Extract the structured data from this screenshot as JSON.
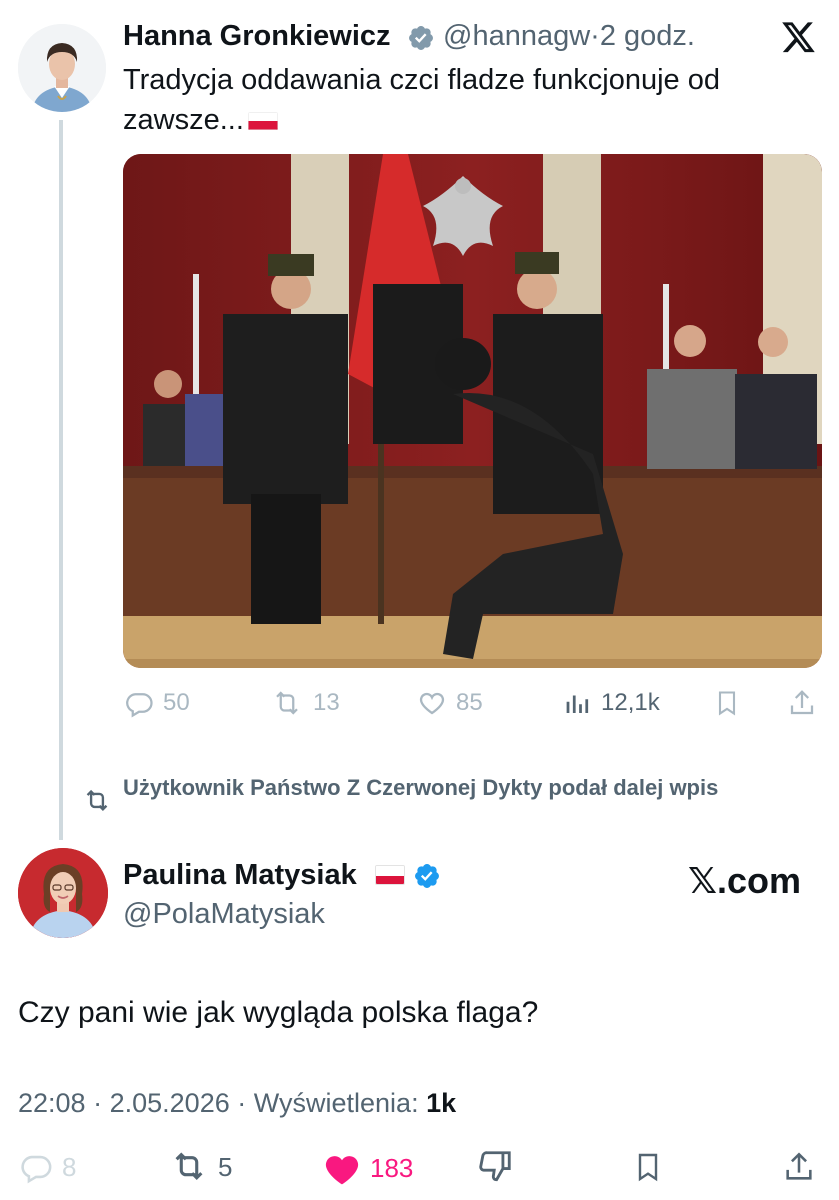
{
  "quoted_tweet": {
    "author_name": "Hanna Gronkiewicz",
    "handle": "@hannagw",
    "separator": "·",
    "time": "2 godz.",
    "text": "Tradycja oddawania czci fladze funkcjonuje od zawsze...",
    "actions": {
      "replies": "50",
      "reposts": "13",
      "likes": "85",
      "views": "12,1k"
    }
  },
  "repost_notice": "Użytkownik Państwo Z Czerwonej Dykty podał dalej wpis",
  "main_tweet": {
    "author_name": "Paulina Matysiak",
    "handle": "@PolaMatysiak",
    "text": "Czy pani wie jak wygląda polska flaga?",
    "time": "22:08",
    "date": "2.05.2026",
    "separator": "·",
    "views_label": "Wyświetlenia:",
    "views_value": "1k",
    "actions": {
      "replies": "8",
      "reposts": "5",
      "likes": "183"
    }
  },
  "watermark": "𝕏.com",
  "colors": {
    "verified_blue": "#1d9bf0",
    "verified_gray": "#829aab",
    "like_pink": "#f91880",
    "muted": "#536471",
    "flag_red": "#dc143c"
  },
  "icons": [
    "verified-badge",
    "x-logo",
    "reply",
    "repost",
    "like",
    "views",
    "bookmark",
    "share",
    "dislike"
  ]
}
